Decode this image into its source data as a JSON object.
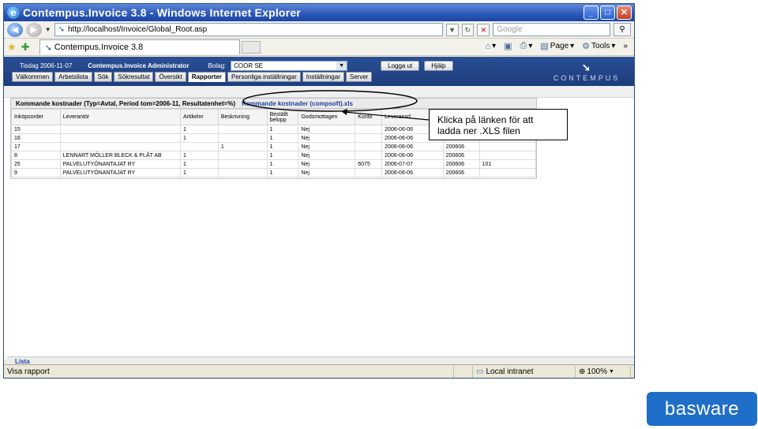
{
  "window": {
    "title": "Contempus.Invoice 3.8 - Windows Internet Explorer",
    "address": "http://localhost/Invoice/Global_Root.asp",
    "search_placeholder": "Google",
    "tab_title": "Contempus.Invoice 3.8",
    "commands": [
      "Page",
      "Tools"
    ]
  },
  "app": {
    "date_label": "Tisdag 2006-11-07",
    "app_name": "Contempus.Invoice Administrator",
    "company_label": "Bolag:",
    "company_value": "COOR SE",
    "logout": "Logga ut",
    "help": "Hjälp",
    "tabs": [
      "Välkommen",
      "Arbetslista",
      "Sök",
      "Sökresultat",
      "Översikt",
      "Rapporter",
      "Personliga inställningar",
      "Inställningar",
      "Server"
    ],
    "active_tab": "Rapporter",
    "logo_text": "CONTEMPUS"
  },
  "report": {
    "title": "Kommande kostnader (Typ=Avtal, Period tom=2006-11, Resultatenhet=%)",
    "link": "Kommande kostnader (compsoft).xls",
    "columns": [
      "Inköpsorder",
      "Leverantör",
      "Artikelnr",
      "Beskrivning",
      "Beställt belopp",
      "Godsmottagen",
      "Konto",
      "Leveransd",
      "",
      ""
    ],
    "rows": [
      [
        "15",
        "",
        "1",
        "",
        "1",
        "Nej",
        "",
        "2006-06-06",
        "",
        ""
      ],
      [
        "16",
        "",
        "1",
        "",
        "1",
        "Nej",
        "",
        "2006-06-06",
        "",
        ""
      ],
      [
        "17",
        "",
        "",
        "1",
        "1",
        "Nej",
        "",
        "2006-06-06",
        "200606",
        ""
      ],
      [
        "8",
        "LENNART MÖLLER BLECK & PLÅT AB",
        "1",
        "",
        "1",
        "Nej",
        "",
        "2006-06-06",
        "200606",
        ""
      ],
      [
        "25",
        "PALVELUTYÖNANTAJAT RY",
        "1",
        "",
        "1",
        "Nej",
        "6075",
        "2006-07-07",
        "200606",
        "101"
      ],
      [
        "9",
        "PALVELUTYÖNANTAJAT RY",
        "1",
        "",
        "1",
        "Nej",
        "",
        "2006-06-06",
        "200606",
        ""
      ]
    ]
  },
  "bottom_label": "Lista",
  "status": {
    "left": "Visa rapport",
    "zone": "Local intranet",
    "zoom": "100%"
  },
  "callout": "Klicka på länken för att ladda ner .XLS filen",
  "brand": "basware"
}
